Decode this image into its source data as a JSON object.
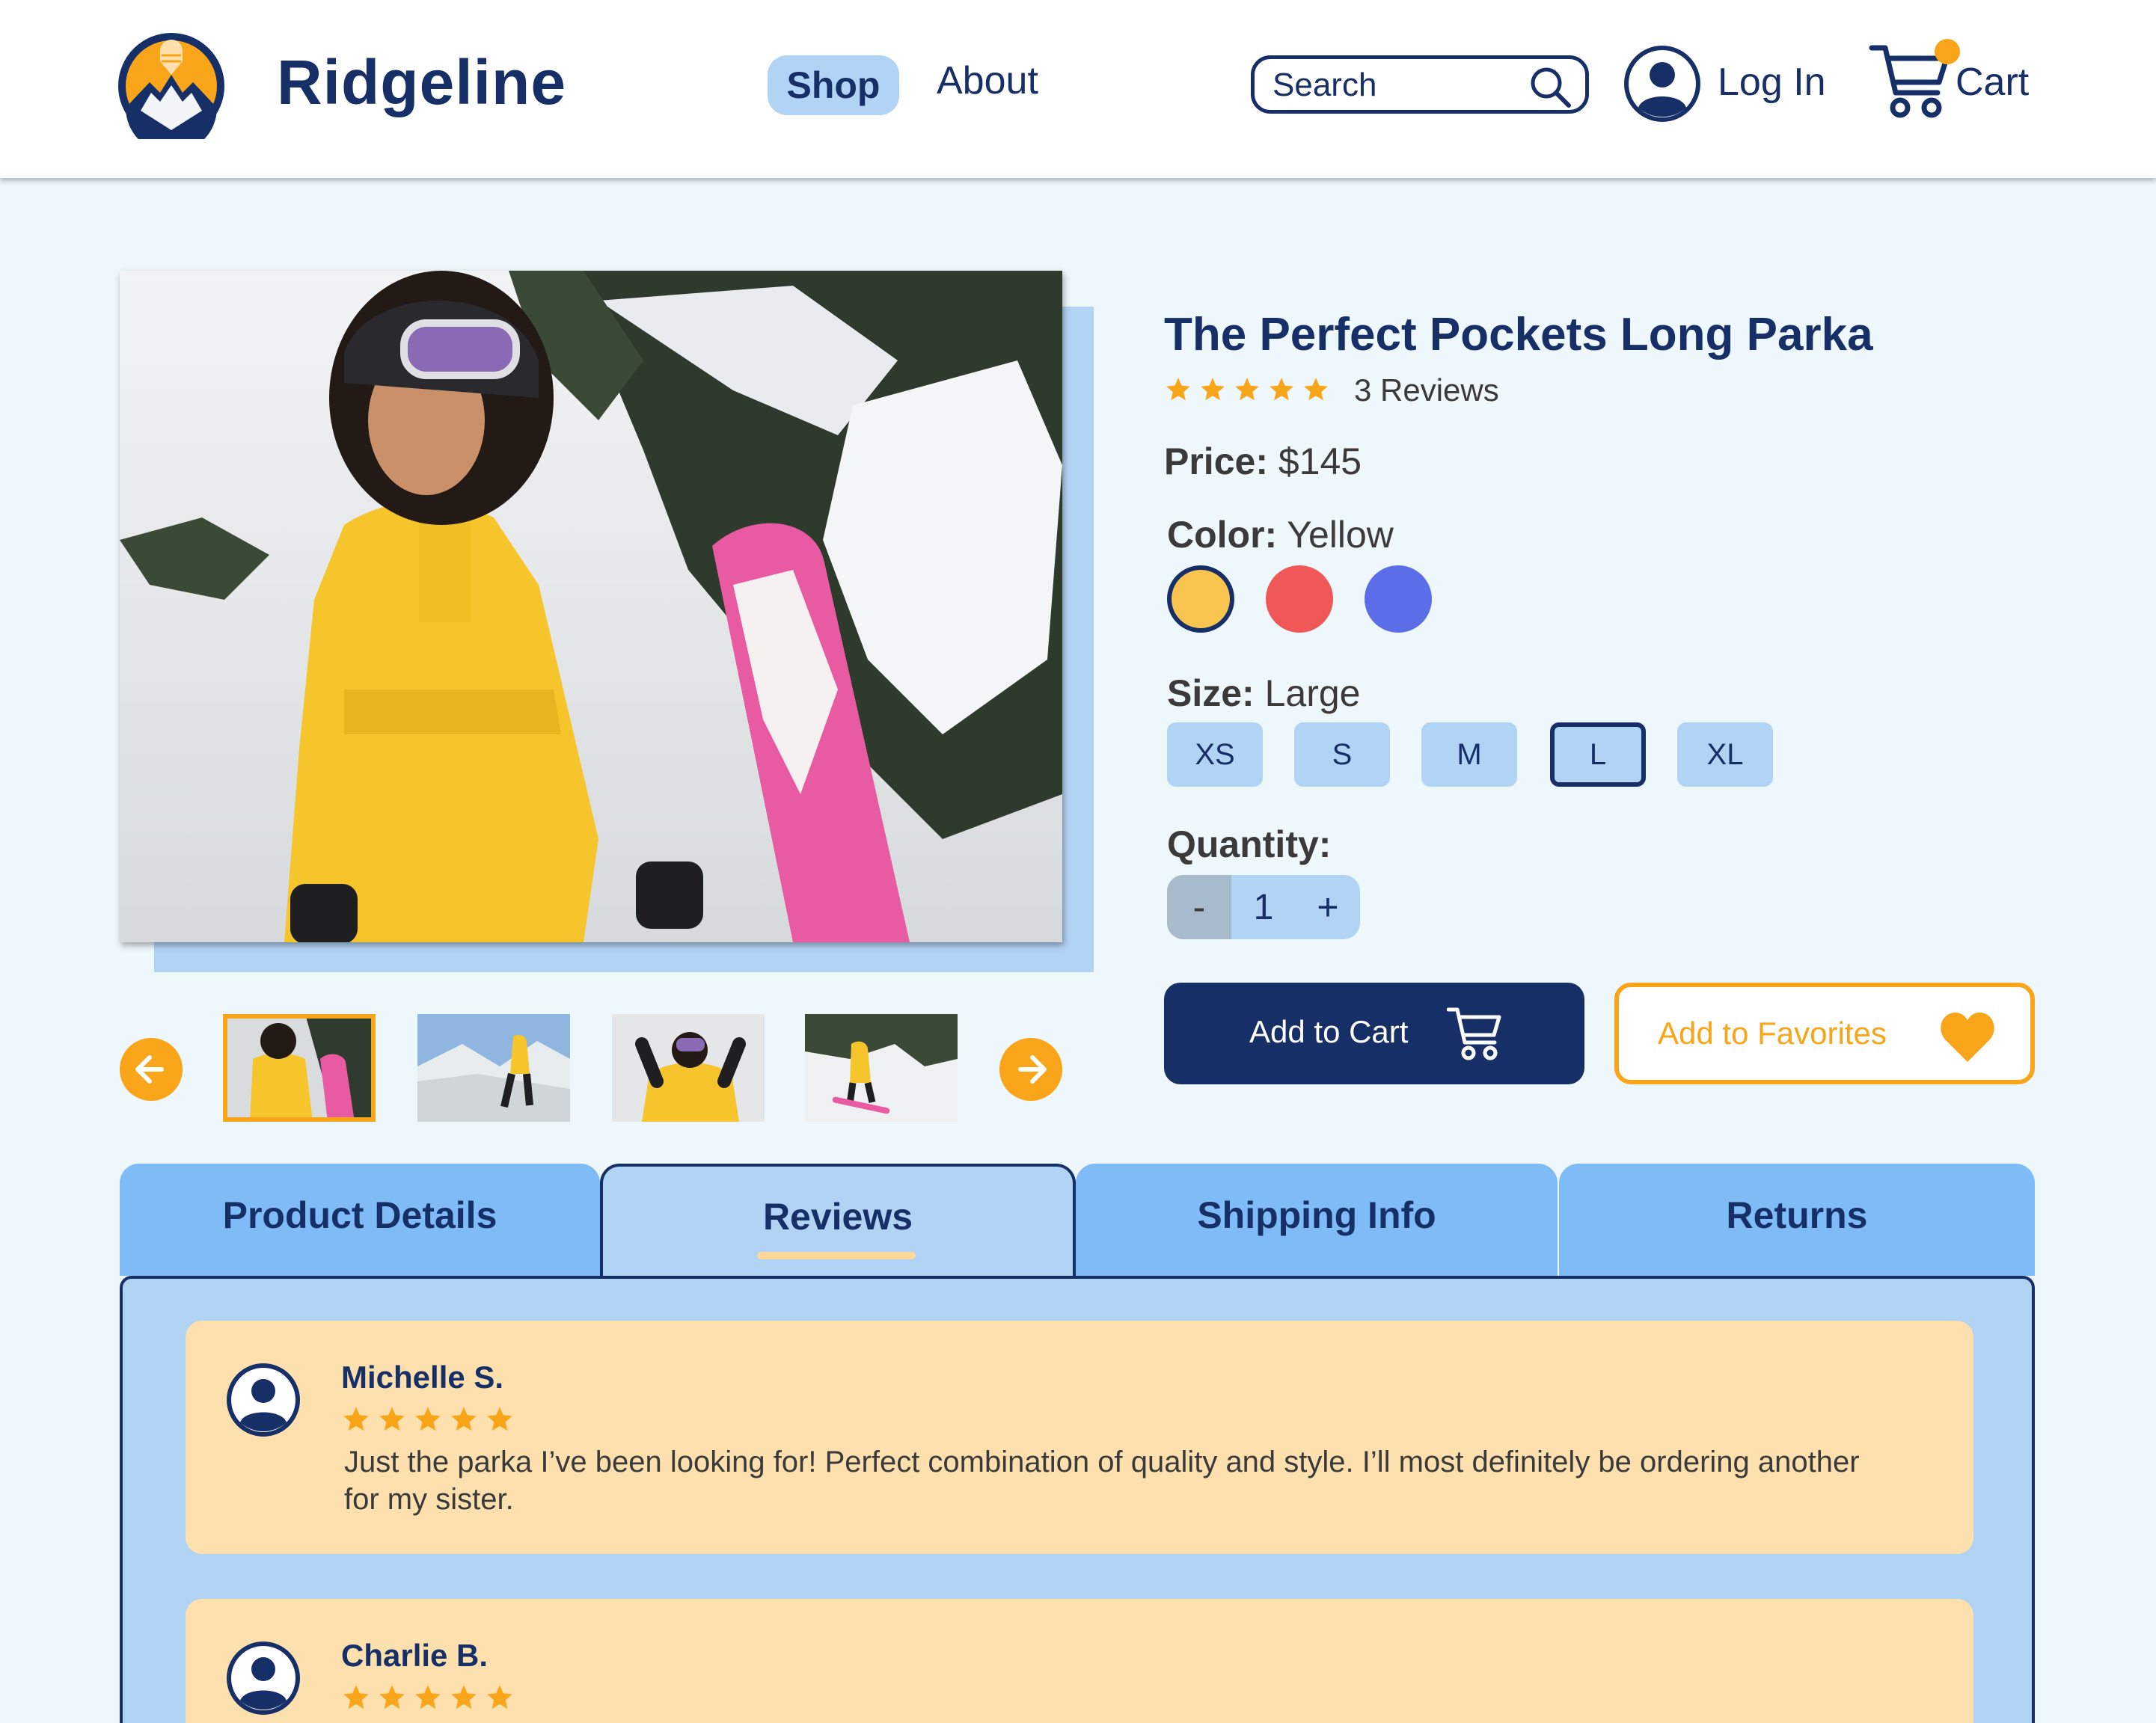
{
  "header": {
    "brand": "Ridgeline",
    "nav": {
      "shop": "Shop",
      "about": "About"
    },
    "search_placeholder": "Search",
    "login": "Log In",
    "cart": "Cart"
  },
  "product": {
    "title": "The Perfect Pockets Long Parka",
    "rating": 5,
    "reviews_label": "3 Reviews",
    "price_label": "Price:",
    "price": "$145",
    "color_label": "Color:",
    "color_value": "Yellow",
    "colors": [
      {
        "name": "Yellow",
        "hex": "#f8c44f",
        "selected": true
      },
      {
        "name": "Red",
        "hex": "#f05757",
        "selected": false
      },
      {
        "name": "Blue",
        "hex": "#5b6ee8",
        "selected": false
      }
    ],
    "size_label": "Size:",
    "size_value": "Large",
    "sizes": [
      "XS",
      "S",
      "M",
      "L",
      "XL"
    ],
    "selected_size": "L",
    "quantity_label": "Quantity:",
    "quantity": "1",
    "qty_minus": "-",
    "qty_plus": "+",
    "add_to_cart": "Add to Cart",
    "add_to_favorites": "Add to Favorites"
  },
  "gallery": {
    "thumbnail_count": 4,
    "active_thumbnail": 1
  },
  "tabs": [
    "Product Details",
    "Reviews",
    "Shipping Info",
    "Returns"
  ],
  "active_tab": "Reviews",
  "reviews": [
    {
      "name": "Michelle S.",
      "rating": 5,
      "text": "Just the parka I’ve been looking for! Perfect combination of quality and style. I’ll most definitely be ordering another for my sister."
    },
    {
      "name": "Charlie B.",
      "rating": 5,
      "text": ""
    }
  ],
  "colors": {
    "navy": "#172f67",
    "accent": "#f9a51a",
    "light_blue": "#b1d3f4",
    "tab_blue": "#7fbcf7",
    "review_bg": "#fde0ad",
    "page_bg": "#eef7fc"
  }
}
